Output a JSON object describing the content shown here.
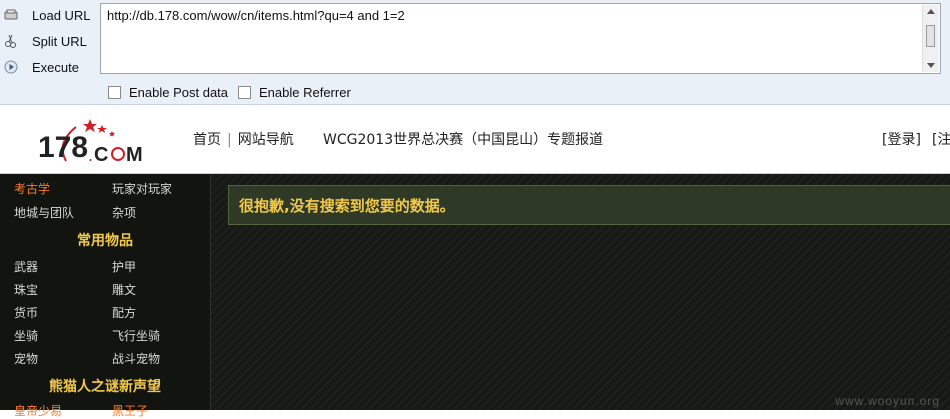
{
  "hackbar": {
    "buttons": [
      {
        "label": "Load URL",
        "icon": "load-url-icon"
      },
      {
        "label": "Split URL",
        "icon": "scissors-icon"
      },
      {
        "label": "Execute",
        "icon": "play-icon"
      }
    ],
    "url_value": "http://db.178.com/wow/cn/items.html?qu=4 and 1=2",
    "checkboxes": [
      {
        "label": "Enable Post data",
        "checked": false
      },
      {
        "label": "Enable Referrer",
        "checked": false
      }
    ]
  },
  "header": {
    "logo_text": "178.COM",
    "nav": {
      "home": "首页",
      "site_nav": "网站导航",
      "feature": "WCG2013世界总决赛（中国昆山）专题报道",
      "login": "[登录]",
      "register": "[注"
    }
  },
  "sidebar": {
    "rows": [
      {
        "left": "考古学",
        "right": "玩家对玩家",
        "left_highlight": true
      },
      {
        "left": "地城与团队",
        "right": "杂项"
      }
    ],
    "section1_title": "常用物品",
    "section1_rows": [
      {
        "left": "武器",
        "right": "护甲"
      },
      {
        "left": "珠宝",
        "right": "雕文"
      },
      {
        "left": "货币",
        "right": "配方"
      },
      {
        "left": "坐骑",
        "right": "飞行坐骑"
      },
      {
        "left": "宠物",
        "right": "战斗宠物"
      }
    ],
    "section2_title": "熊猫人之谜新声望",
    "section2_rows": [
      {
        "left": "皇帝少易",
        "right": "黑王子"
      }
    ]
  },
  "main": {
    "message": "很抱歉,没有搜索到您要的数据。"
  },
  "watermark": "www.wooyun.org",
  "colors": {
    "toolbar_bg": "#e9f0f8",
    "sidebar_bg": "#121410",
    "accent_gold": "#f2c94c",
    "highlight_orange": "#ff7a2e",
    "message_bg": "#2f3a26"
  }
}
